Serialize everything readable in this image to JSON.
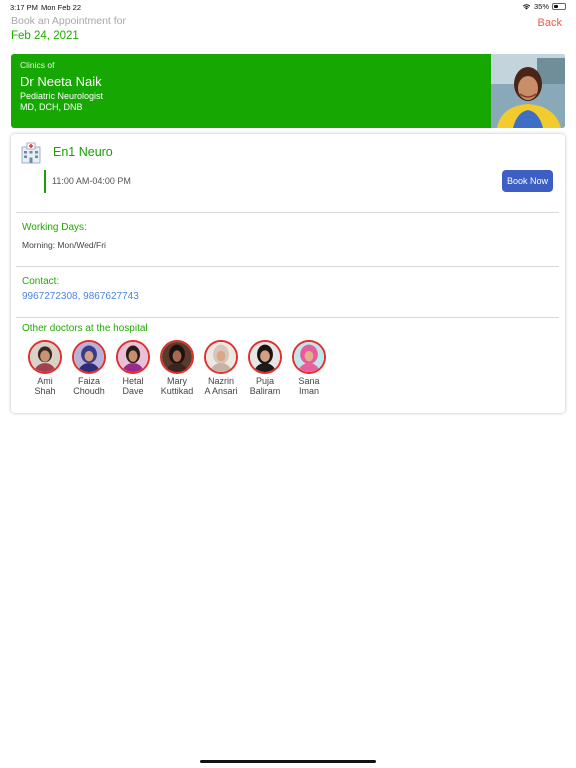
{
  "status_bar": {
    "time": "3:17 PM",
    "date": "Mon Feb 22",
    "battery": "35%",
    "battery_level": 0.35
  },
  "header": {
    "title": "Book an Appointment for",
    "date": "Feb 24, 2021",
    "back_label": "Back"
  },
  "banner": {
    "label": "Clinics of",
    "doctor_name": "Dr Neeta Naik",
    "specialty": "Pediatric Neurologist",
    "degrees": "MD, DCH, DNB",
    "bg_color": "#17a703"
  },
  "clinic": {
    "name": "En1 Neuro",
    "slot": "11:00 AM-04:00 PM",
    "book_label": "Book Now",
    "working_days_label": "Working Days:",
    "working_days": "Morning: Mon/Wed/Fri",
    "contact_label": "Contact:",
    "contact": "9967272308, 9867627743",
    "other_doctors_label": "Other doctors at the hospital"
  },
  "other_doctors": [
    {
      "first": "Ami",
      "last": "Shah"
    },
    {
      "first": "Faiza",
      "last": "Choudh"
    },
    {
      "first": "Hetal",
      "last": "Dave"
    },
    {
      "first": "Mary",
      "last": "Kuttikad"
    },
    {
      "first": "Nazrin",
      "last": "A Ansari"
    },
    {
      "first": "Puja",
      "last": "Baliram"
    },
    {
      "first": "Sana",
      "last": "Iman"
    }
  ],
  "colors": {
    "accent_green": "#1ea00a",
    "back_red": "#f05a47",
    "button_blue": "#3d5ec3",
    "link_blue": "#4a84e4",
    "avatar_ring": "#e0302c"
  }
}
